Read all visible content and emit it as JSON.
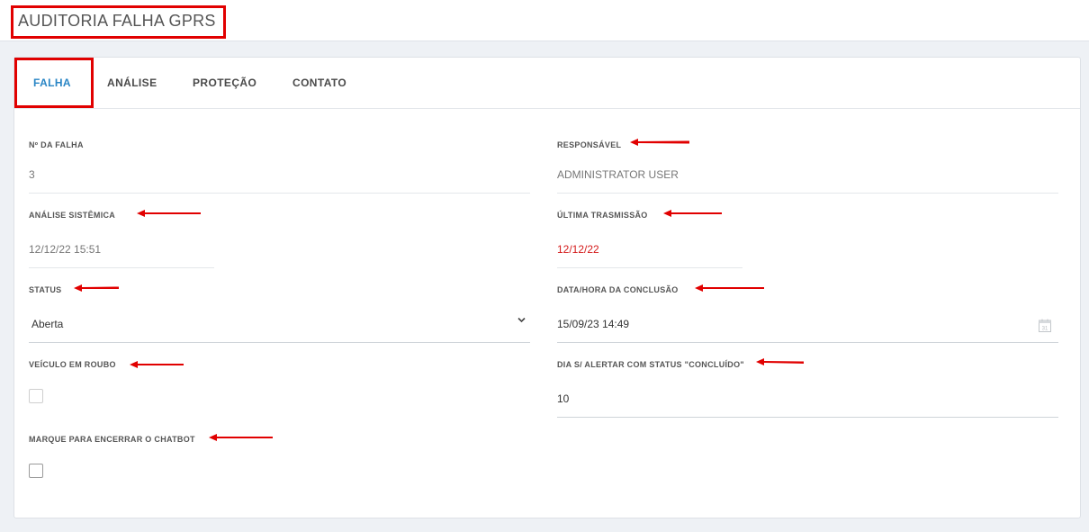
{
  "header": {
    "title": "AUDITORIA FALHA GPRS"
  },
  "tabs": [
    {
      "label": "FALHA",
      "active": true
    },
    {
      "label": "ANÁLISE",
      "active": false
    },
    {
      "label": "PROTEÇÃO",
      "active": false
    },
    {
      "label": "CONTATO",
      "active": false
    }
  ],
  "fields": {
    "numero_falha": {
      "label": "Nº DA FALHA",
      "value": "3"
    },
    "responsavel": {
      "label": "RESPONSÁVEL",
      "value": "ADMINISTRATOR USER"
    },
    "analise_sistemica": {
      "label": "ANÁLISE SISTÊMICA",
      "value": "12/12/22 15:51"
    },
    "ultima_transmissao": {
      "label": "ÚLTIMA TRASMISSÃO",
      "value": "12/12/22"
    },
    "status": {
      "label": "STATUS",
      "value": "Aberta"
    },
    "data_conclusao": {
      "label": "DATA/HORA DA CONCLUSÃO",
      "value": "15/09/23 14:49"
    },
    "veiculo_roubo": {
      "label": "VEÍCULO EM ROUBO",
      "checked": false
    },
    "dia_alertar": {
      "label": "DIA S/ ALERTAR COM STATUS \"CONCLUÍDO\"",
      "value": "10"
    },
    "encerrar_chatbot": {
      "label": "MARQUE PARA ENCERRAR O CHATBOT",
      "checked": false
    }
  },
  "colors": {
    "accent": "#2a86c5",
    "annotation": "#e10000",
    "alert_value": "#d41a1a"
  },
  "icons": {
    "status_dropdown": "chevron-down-icon",
    "date_picker": "calendar-icon",
    "annotation": "red-arrow-icon"
  }
}
